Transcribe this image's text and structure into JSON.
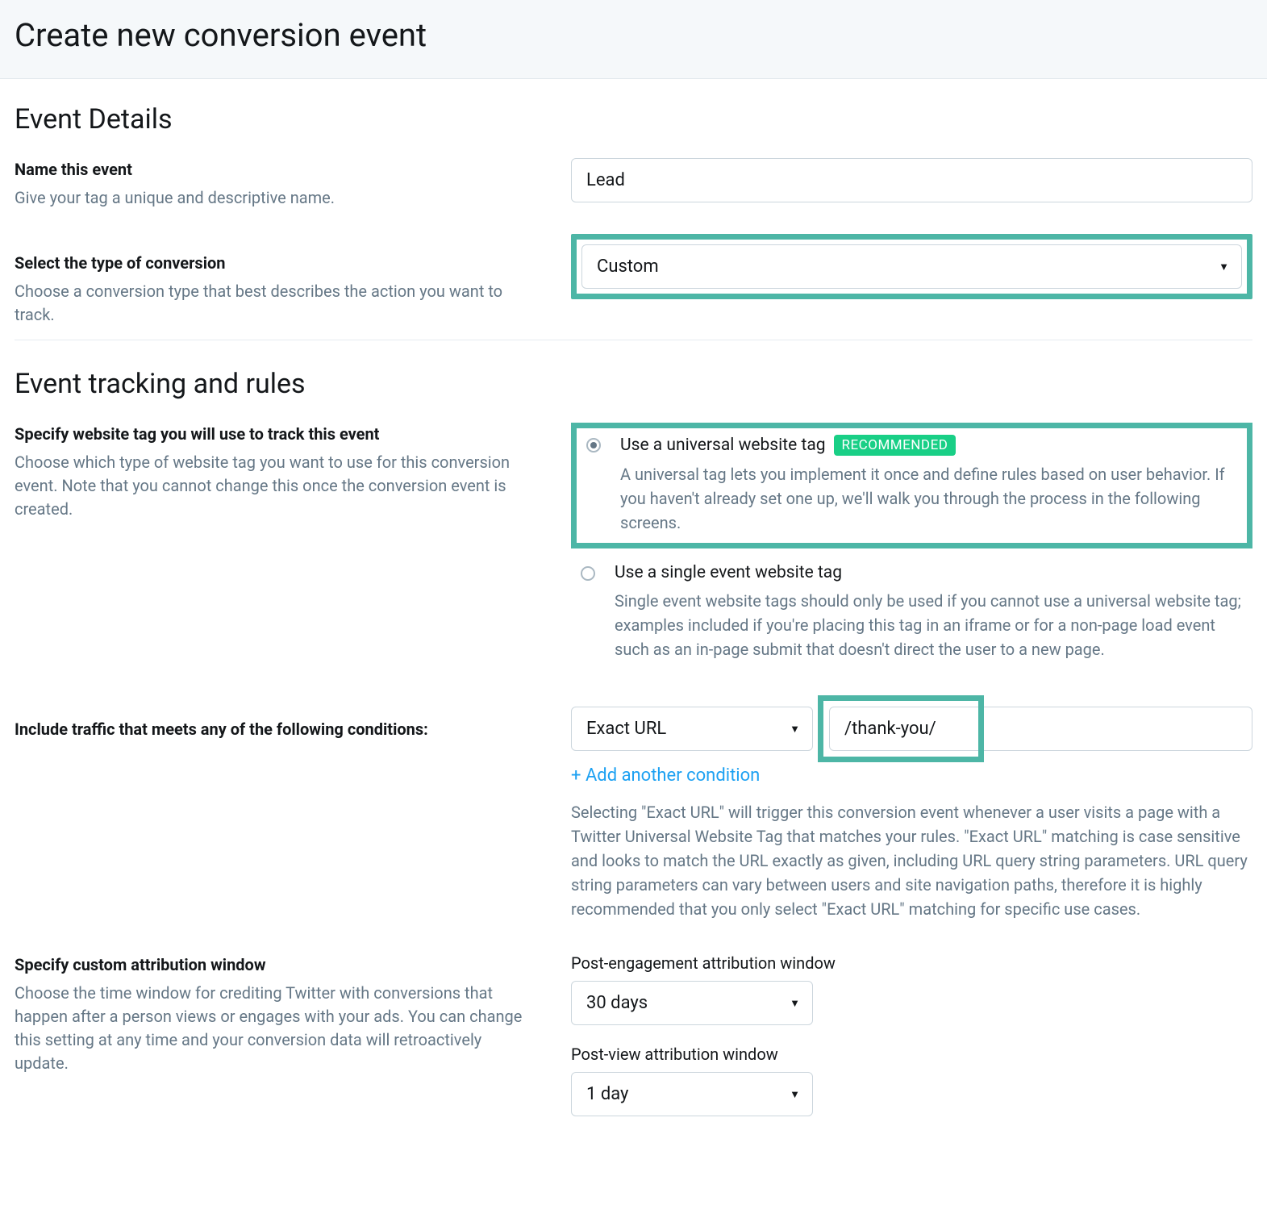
{
  "header": {
    "title": "Create new conversion event"
  },
  "eventDetails": {
    "sectionTitle": "Event Details",
    "name": {
      "label": "Name this event",
      "help": "Give your tag a unique and descriptive name.",
      "value": "Lead"
    },
    "type": {
      "label": "Select the type of conversion",
      "help": "Choose a conversion type that best describes the action you want to track.",
      "value": "Custom"
    }
  },
  "tracking": {
    "sectionTitle": "Event tracking and rules",
    "tagChoice": {
      "label": "Specify website tag you will use to track this event",
      "help": "Choose which type of website tag you want to use for this conversion event. Note that you cannot change this once the conversion event is created.",
      "universal": {
        "label": "Use a universal website tag",
        "badge": "RECOMMENDED",
        "desc": "A universal tag lets you implement it once and define rules based on user behavior. If you haven't already set one up, we'll walk you through the process in the following screens."
      },
      "single": {
        "label": "Use a single event website tag",
        "desc": "Single event website tags should only be used if you cannot use a universal website tag; examples included if you're placing this tag in an iframe or for a non-page load event such as an in-page submit that doesn't direct the user to a new page."
      }
    },
    "conditions": {
      "label": "Include traffic that meets any of the following conditions:",
      "matchType": "Exact URL",
      "urlValue": "/thank-you/",
      "addLink": "+ Add another condition",
      "helpText": "Selecting \"Exact URL\" will trigger this conversion event whenever a user visits a page with a Twitter Universal Website Tag that matches your rules. \"Exact URL\" matching is case sensitive and looks to match the URL exactly as given, including URL query string parameters. URL query string parameters can vary between users and site navigation paths, therefore it is highly recommended that you only select \"Exact URL\" matching for specific use cases."
    },
    "attribution": {
      "label": "Specify custom attribution window",
      "help": "Choose the time window for crediting Twitter with conversions that happen after a person views or engages with your ads. You can change this setting at any time and your conversion data will retroactively update.",
      "postEngagement": {
        "label": "Post-engagement attribution window",
        "value": "30 days"
      },
      "postView": {
        "label": "Post-view attribution window",
        "value": "1 day"
      }
    }
  }
}
